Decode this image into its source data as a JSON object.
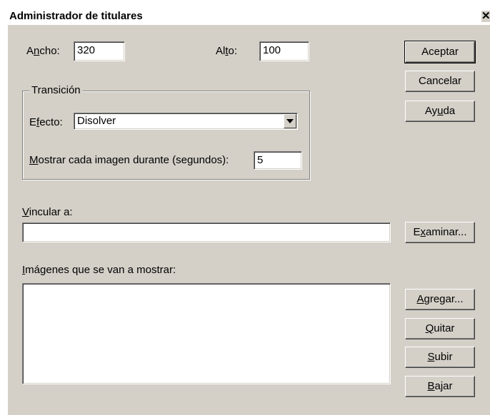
{
  "window": {
    "title": "Administrador de titulares",
    "close_glyph": "✕"
  },
  "size": {
    "width_label_pre": "A",
    "width_label_key": "n",
    "width_label_post": "cho:",
    "width_value": "320",
    "height_label_pre": "Al",
    "height_label_key": "t",
    "height_label_post": "o:",
    "height_value": "100"
  },
  "transition": {
    "group_label": "Transición",
    "effect_label_pre": "E",
    "effect_label_key": "f",
    "effect_label_post": "ecto:",
    "effect_value": "Disolver",
    "duration_label_key": "M",
    "duration_label_post": "ostrar cada imagen durante (segundos):",
    "duration_value": "5"
  },
  "link": {
    "label_key": "V",
    "label_post": "incular a:",
    "value": ""
  },
  "images": {
    "label_key": "I",
    "label_post": "mágenes que se van a mostrar:"
  },
  "buttons": {
    "accept": "Aceptar",
    "cancel": "Cancelar",
    "help_pre": "Ay",
    "help_key": "u",
    "help_post": "da",
    "browse_pre": "E",
    "browse_key": "x",
    "browse_post": "aminar...",
    "add_key": "A",
    "add_post": "gregar...",
    "remove_key": "Q",
    "remove_post": "uitar",
    "up_key": "S",
    "up_post": "ubir",
    "down_key": "B",
    "down_post": "ajar"
  },
  "icons": {
    "combo_arrow": "chevron-down-icon",
    "close": "close-icon"
  }
}
